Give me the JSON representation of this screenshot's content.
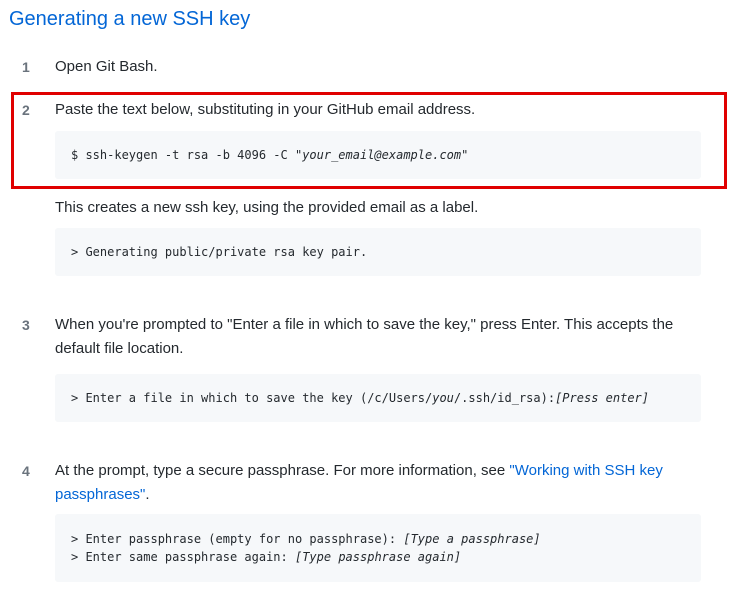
{
  "title": "Generating a new SSH key",
  "steps": {
    "s1": {
      "num": "1",
      "text": "Open Git Bash."
    },
    "s2": {
      "num": "2",
      "text": "Paste the text below, substituting in your GitHub email address.",
      "code_prefix": "$ ssh-keygen -t rsa -b 4096 -C \"",
      "code_italic": "your_email@example.com",
      "code_suffix": "\"",
      "after_text": "This creates a new ssh key, using the provided email as a label.",
      "output": "> Generating public/private rsa key pair."
    },
    "s3": {
      "num": "3",
      "text": "When you're prompted to \"Enter a file in which to save the key,\" press Enter. This accepts the default file location.",
      "code_a": "> Enter a file in which to save the key (/c/Users/",
      "code_italic_user": "you",
      "code_b": "/.ssh/id_rsa):",
      "code_italic_press": "[Press enter]"
    },
    "s4": {
      "num": "4",
      "text_before": "At the prompt, type a secure passphrase. For more information, see ",
      "link": "\"Working with SSH key passphrases\"",
      "text_after": ".",
      "line1_prefix": "> Enter passphrase (empty for no passphrase): ",
      "line1_italic": "[Type a passphrase]",
      "line2_prefix": "> Enter same passphrase again: ",
      "line2_italic": "[Type passphrase again]"
    }
  },
  "colors": {
    "link": "#0366d6",
    "highlight_border": "#e00000",
    "code_bg": "#f6f8fa"
  }
}
